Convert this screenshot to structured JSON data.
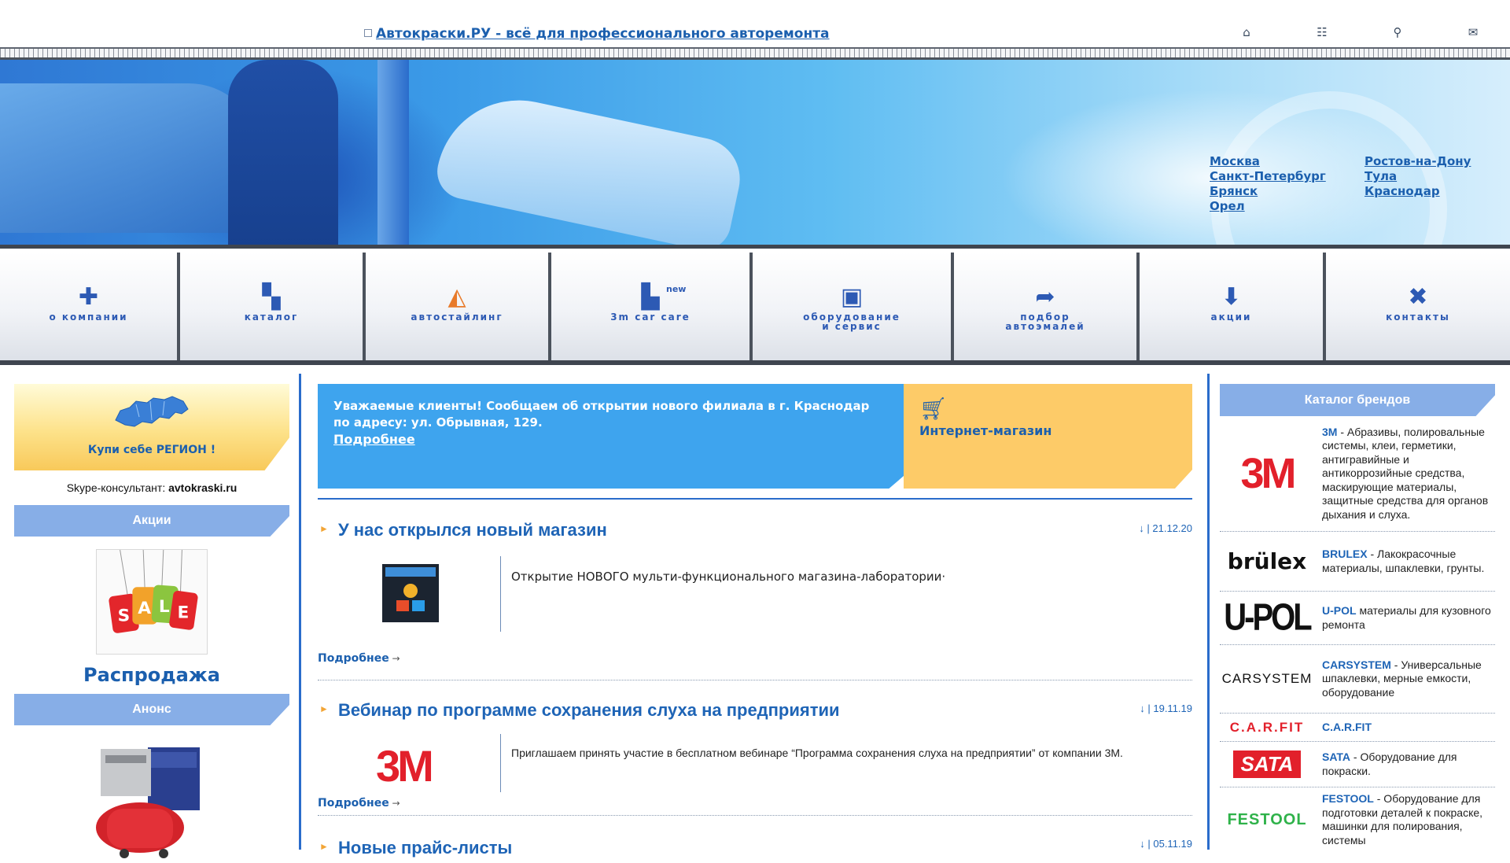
{
  "header": {
    "site_link": "Автокраски.РУ - всё для профессионального авторемонта",
    "icons": [
      "home-icon",
      "sitemap-icon",
      "search-icon",
      "mail-icon"
    ]
  },
  "cities": {
    "col1": [
      "Москва",
      "Санкт-Петербург",
      "Брянск",
      "Орел"
    ],
    "col2": [
      "Ростов-на-Дону",
      "Тула",
      "Краснодар"
    ]
  },
  "nav": [
    {
      "label": "о компании",
      "icon": "company-icon"
    },
    {
      "label": "каталог",
      "icon": "catalog-icon"
    },
    {
      "label": "автостайлинг",
      "icon": "styling-icon"
    },
    {
      "label": "3m car care",
      "icon": "carcare-icon",
      "badge": "new"
    },
    {
      "label": "оборудование\nи сервис",
      "icon": "equipment-icon"
    },
    {
      "label": "подбор\nавтоэмалей",
      "icon": "enamel-icon"
    },
    {
      "label": "акции",
      "icon": "promo-arrow-icon"
    },
    {
      "label": "контакты",
      "icon": "contacts-icon"
    }
  ],
  "left": {
    "region_link": "Купи себе РЕГИОН !",
    "skype_label": "Skype-консультант:",
    "skype_id": "avtokraski.ru",
    "promo_head": "Акции",
    "sale_link": "Распродажа",
    "anons_head": "Анонс"
  },
  "promo": {
    "text_line1": "Уважаемые клиенты! Сообщаем об открытии нового филиала в г. Краснодар",
    "text_line2": "по адресу: ул. Обрывная, 129.",
    "more": "Подробнее",
    "shop_link": "Интернет-магазин"
  },
  "news": [
    {
      "title": "У нас открылся новый магазин",
      "date": "21.12.20",
      "text": "Открытие НОВОГО мульти-функционального магазина-лаборатории·",
      "more": "Подробнее"
    },
    {
      "title": "Вебинар по программе сохранения слуха на предприятии",
      "date": "19.11.19",
      "text": "Приглашаем принять участие в бесплатном вебинаре “Программа сохранения слуха на предприятии” от компании 3М.",
      "more": "Подробнее"
    },
    {
      "title": "Новые прайс-листы",
      "date": "05.11.19"
    }
  ],
  "brands": {
    "head": "Каталог брендов",
    "items": [
      {
        "name": "3M",
        "desc": " - Абразивы, полировальные системы, клеи, герметики, антигравийные и антикоррозийные средства, маскирующие материалы, защитные средства для органов дыхания и слуха.",
        "logo": "3M"
      },
      {
        "name": "BRULEX",
        "desc": " - Лакокрасочные материалы, шпаклевки, грунты.",
        "logo": "brülex"
      },
      {
        "name": "U-POL",
        "desc": " материалы для кузовного ремонта",
        "logo": "U-POL"
      },
      {
        "name": "CARSYSTEM",
        "desc": " - Универсальные шпаклевки, мерные емкости, оборудование",
        "logo": "CARSYSTEM"
      },
      {
        "name": "C.A.R.FIT",
        "desc": "",
        "logo": "C.A.R.FIT"
      },
      {
        "name": "SATA",
        "desc": " - Оборудование для покраски.",
        "logo": "SATA"
      },
      {
        "name": "FESTOOL",
        "desc": " - Оборудование для подготовки деталей к покраске, машинки для полирования, системы",
        "logo": "FESTOOL"
      }
    ]
  },
  "colors": {
    "accent_blue": "#3ea4ee",
    "accent_yellow": "#fdcb68",
    "link": "#1b5fae",
    "side_head": "#87aee7"
  }
}
